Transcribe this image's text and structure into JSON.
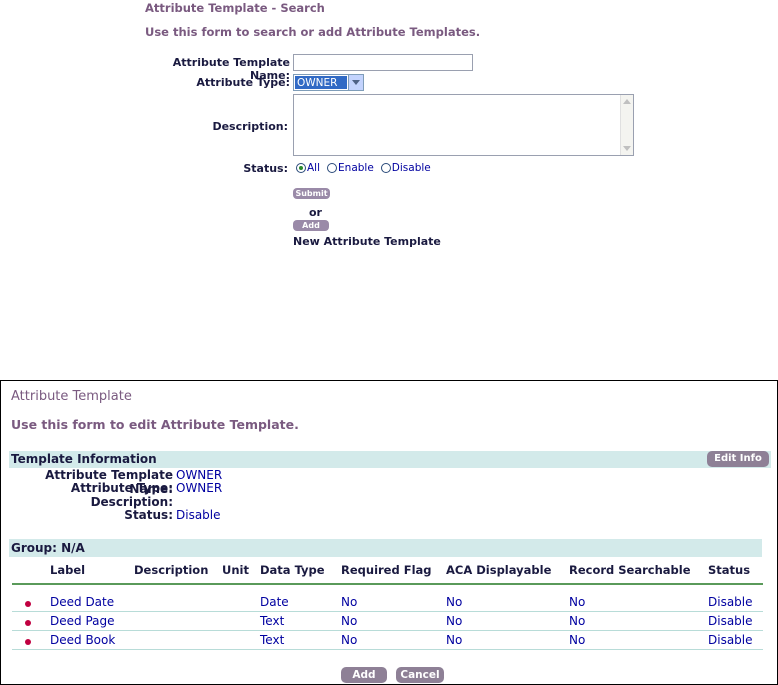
{
  "search": {
    "title": "Attribute Template - Search",
    "instructions": "Use this form to search or add Attribute Templates.",
    "name_label": "Attribute Template Name:",
    "name_value": "",
    "type_label": "Attribute Type:",
    "type_value": "OWNER",
    "description_label": "Description:",
    "description_value": "",
    "status_label": "Status:",
    "status_options": [
      "All",
      "Enable",
      "Disable"
    ],
    "status_selected": "All",
    "submit_label": "Submit",
    "or_text": "or",
    "add_label": "Add",
    "new_template_text": "New Attribute Template"
  },
  "edit": {
    "title": "Attribute Template",
    "instructions": "Use this form to edit Attribute Template.",
    "section_title": "Template Information",
    "edit_info_label": "Edit Info",
    "info": {
      "name_label": "Attribute Template Name:",
      "name_value": "OWNER",
      "type_label": "Attribute Type:",
      "type_value": "OWNER",
      "description_label": "Description:",
      "description_value": "",
      "status_label": "Status:",
      "status_value": "Disable"
    },
    "group_title": "Group: N/A",
    "columns": [
      "Label",
      "Description",
      "Unit",
      "Data Type",
      "Required Flag",
      "ACA Displayable",
      "Record Searchable",
      "Status"
    ],
    "rows": [
      {
        "label": "Deed Date",
        "description": "",
        "unit": "",
        "data_type": "Date",
        "required": "No",
        "aca": "No",
        "searchable": "No",
        "status": "Disable"
      },
      {
        "label": "Deed Page",
        "description": "",
        "unit": "",
        "data_type": "Text",
        "required": "No",
        "aca": "No",
        "searchable": "No",
        "status": "Disable"
      },
      {
        "label": "Deed Book",
        "description": "",
        "unit": "",
        "data_type": "Text",
        "required": "No",
        "aca": "No",
        "searchable": "No",
        "status": "Disable"
      }
    ],
    "add_label": "Add",
    "cancel_label": "Cancel"
  },
  "colors": {
    "title": "#7a5a80",
    "link": "#0000a0",
    "section_bar": "#d3eaea",
    "button": "#8e8096",
    "bullet": "#c00040"
  }
}
